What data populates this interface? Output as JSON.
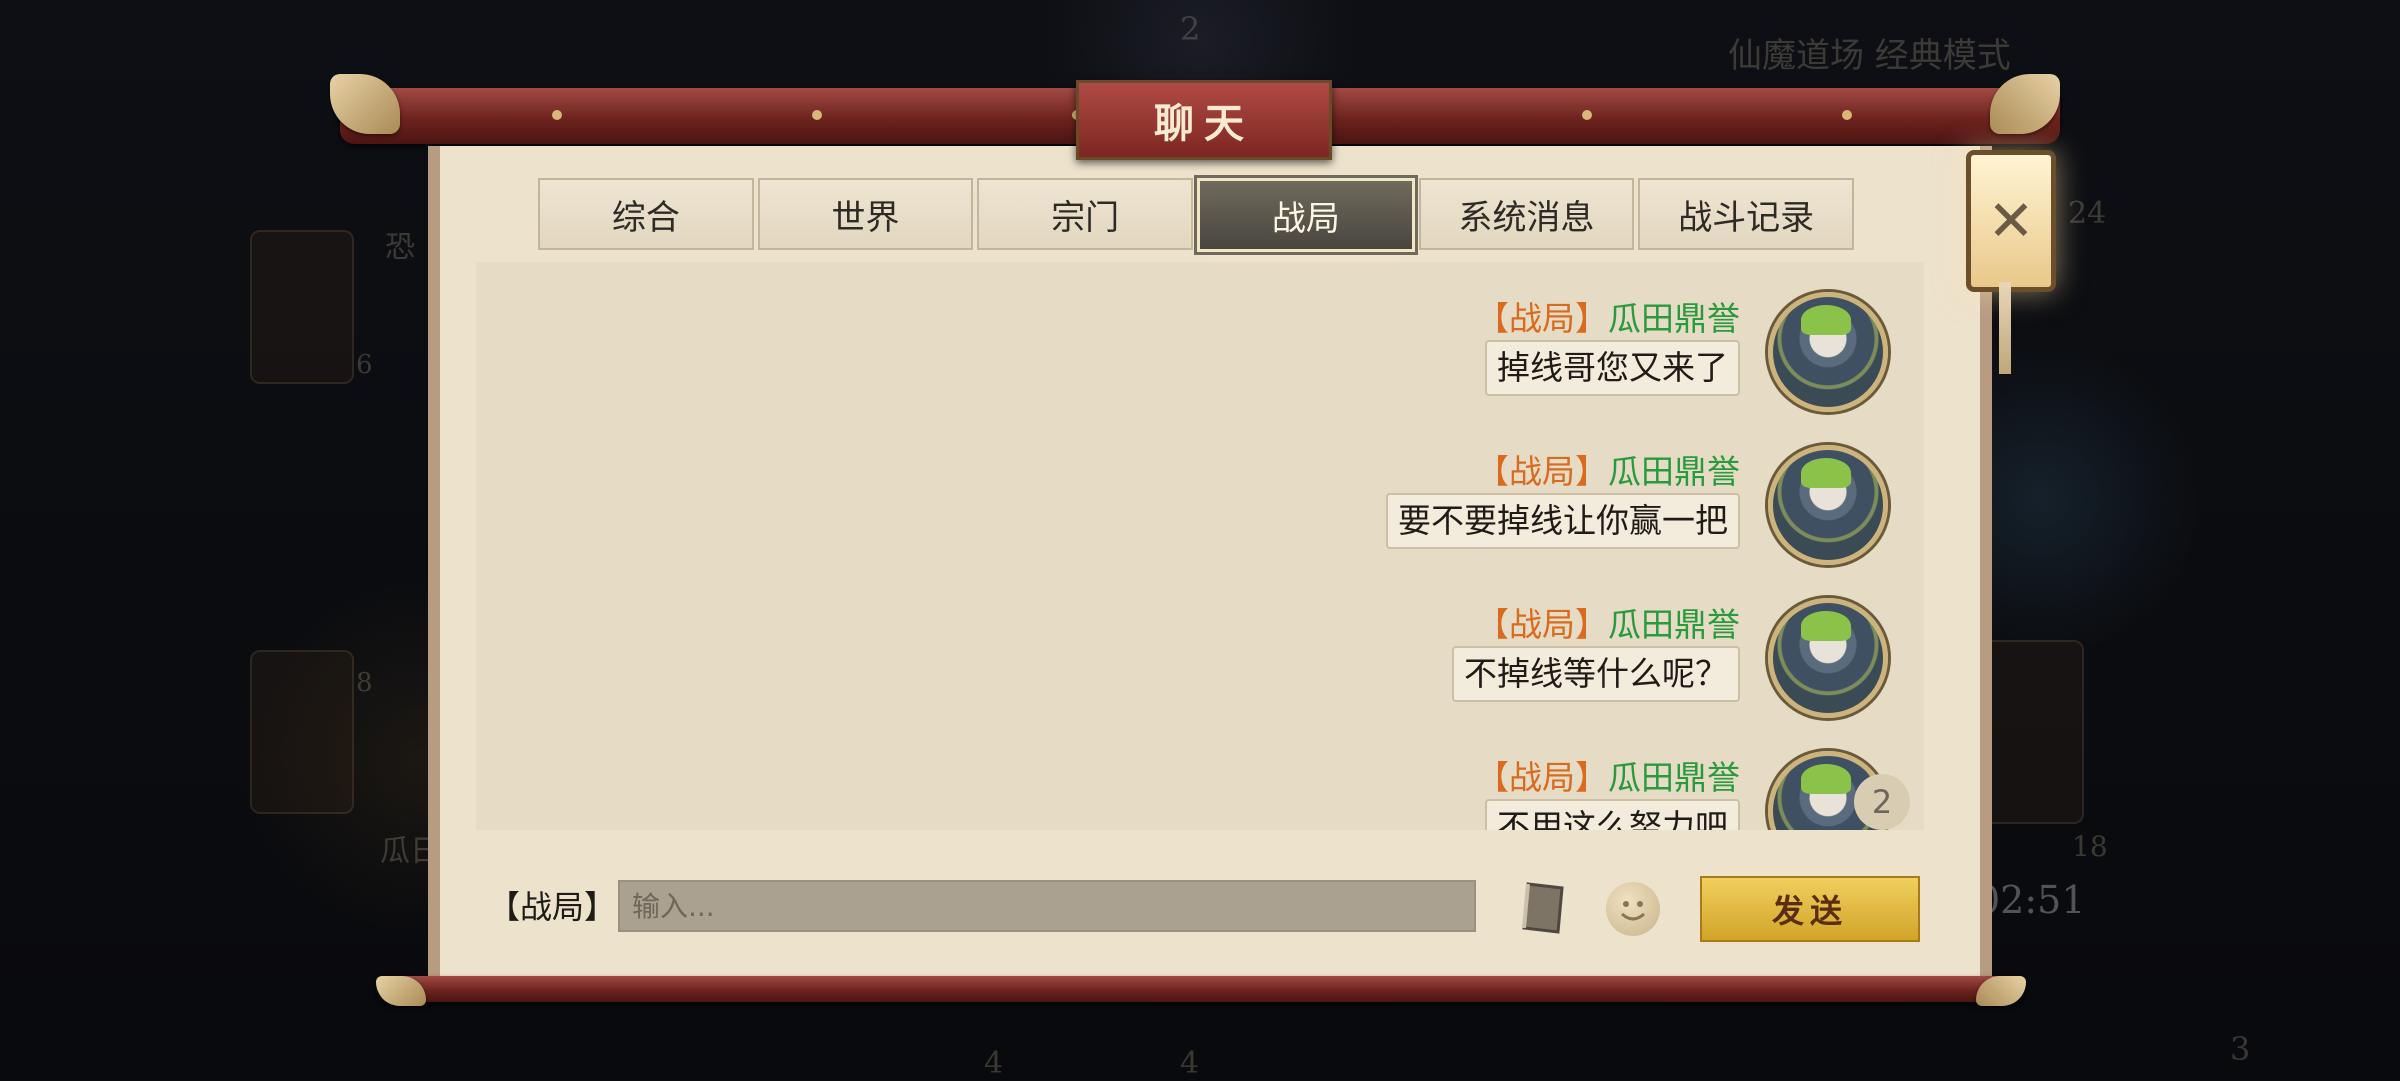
{
  "background": {
    "mode_text": "仙魔道场 经典模式",
    "numbers": [
      "2",
      "24",
      "6",
      "8",
      "18",
      "3",
      "4",
      "4"
    ],
    "player_name_fragments": [
      "恐",
      "瓜日"
    ],
    "timer": "02:51"
  },
  "dialog": {
    "title": "聊天",
    "close_symbol": "✕"
  },
  "tabs": [
    {
      "label": "综合",
      "active": false
    },
    {
      "label": "世界",
      "active": false
    },
    {
      "label": "宗门",
      "active": false
    },
    {
      "label": "战局",
      "active": true
    },
    {
      "label": "系统消息",
      "active": false
    },
    {
      "label": "战斗记录",
      "active": false
    }
  ],
  "messages": [
    {
      "channel": "【战局】",
      "name": "瓜田鼎誉",
      "text": "掉线哥您又来了"
    },
    {
      "channel": "【战局】",
      "name": "瓜田鼎誉",
      "text": "要不要掉线让你赢一把"
    },
    {
      "channel": "【战局】",
      "name": "瓜田鼎誉",
      "text": "不掉线等什么呢？"
    },
    {
      "channel": "【战局】",
      "name": "瓜田鼎誉",
      "text": "不用这么努力吧"
    }
  ],
  "unread_badge": "2",
  "input": {
    "channel_label": "【战局】",
    "placeholder": "输入..."
  },
  "send_label": "发送",
  "icons": {
    "close": "close-icon",
    "book": "book-icon",
    "emoji": "emoji-icon"
  },
  "colors": {
    "channel": "#d86b1f",
    "name": "#2a9a3e",
    "send_button": "#e3b940",
    "scroll_rod": "#8a302b"
  }
}
